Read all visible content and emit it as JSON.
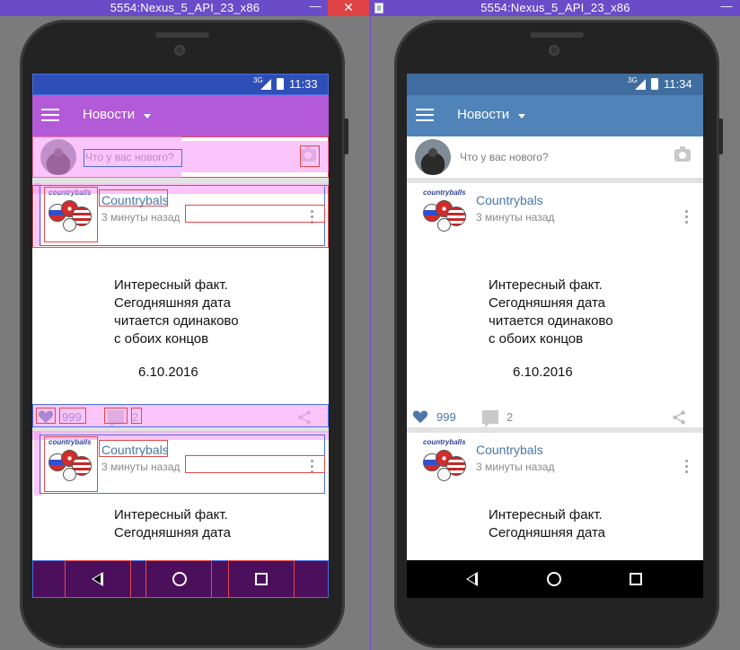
{
  "windows": [
    {
      "id": "design",
      "title": "5554:Nexus_5_API_23_x86",
      "minimize_label": "—",
      "close_label": "✕",
      "statusbar": {
        "network": "3G",
        "time": "11:33"
      },
      "appbar": {
        "title": "Новости"
      },
      "compose": {
        "placeholder": "Что у вас нового?"
      },
      "posts": [
        {
          "logo_text": "countryballs",
          "author": "Countrybals",
          "time": "3 минуты назад",
          "lines": [
            "Интересный факт.",
            "Сегодняшняя дата",
            "читается одинаково",
            "с обоих концов"
          ],
          "date": "6.10.2016",
          "likes": "999",
          "comments": "2"
        },
        {
          "logo_text": "countryballs",
          "author": "Countrybals",
          "time": "3 минуты назад",
          "lines": [
            "Интересный факт.",
            "Сегодняшняя дата"
          ]
        }
      ]
    },
    {
      "id": "running",
      "title": "5554:Nexus_5_API_23_x86",
      "minimize_label": "—",
      "statusbar": {
        "network": "3G",
        "time": "11:34"
      },
      "appbar": {
        "title": "Новости"
      },
      "compose": {
        "placeholder": "Что у вас нового?"
      },
      "posts": [
        {
          "logo_text": "countryballs",
          "author": "Countrybals",
          "time": "3 минуты назад",
          "lines": [
            "Интересный факт.",
            "Сегодняшняя дата",
            "читается одинаково",
            "с обоих концов"
          ],
          "date": "6.10.2016",
          "likes": "999",
          "comments": "2"
        },
        {
          "logo_text": "countryballs",
          "author": "Countrybals",
          "time": "3 минуты назад",
          "lines": [
            "Интересный факт.",
            "Сегодняшняя дата"
          ]
        }
      ]
    }
  ],
  "colors": {
    "accent": "#5083b8",
    "status": "#3f6d9f",
    "like": "#4a76a8",
    "window_title": "#6a4cc9"
  },
  "icons": [
    "menu-icon",
    "caret-icon",
    "camera-icon",
    "kebab-icon",
    "heart-icon",
    "comment-icon",
    "share-icon",
    "back-icon",
    "home-icon",
    "recent-icon"
  ]
}
